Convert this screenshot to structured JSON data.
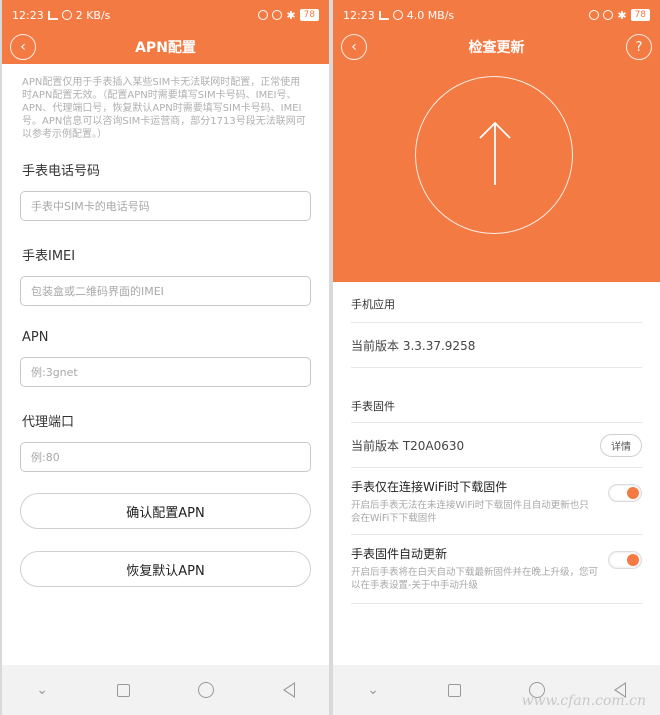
{
  "left": {
    "status": {
      "time": "12:23",
      "signal_text": "5G",
      "speed": "2 KB/s",
      "battery": "78"
    },
    "nav": {
      "title": "APN配置"
    },
    "description": "APN配置仅用于手表插入某些SIM卡无法联网时配置，正常使用时APN配置无效。（配置APN时需要填写SIM卡号码、IMEI号、APN、代理端口号，恢复默认APN时需要填写SIM卡号码、IMEI号。APN信息可以咨询SIM卡运营商，部分1713号段无法联网可以参考示例配置。）",
    "fields": [
      {
        "label": "手表电话号码",
        "placeholder": "手表中SIM卡的电话号码"
      },
      {
        "label": "手表IMEI",
        "placeholder": "包装盒或二维码界面的IMEI"
      },
      {
        "label": "APN",
        "placeholder": "例:3gnet"
      },
      {
        "label": "代理端口",
        "placeholder": "例:80"
      }
    ],
    "buttons": {
      "confirm": "确认配置APN",
      "restore": "恢复默认APN"
    }
  },
  "right": {
    "status": {
      "time": "12:23",
      "signal_text": "5G",
      "speed": "4.0 MB/s",
      "battery": "78"
    },
    "nav": {
      "title": "检查更新",
      "help": "?"
    },
    "app_section": {
      "title": "手机应用",
      "version": "当前版本 3.3.37.9258"
    },
    "firmware_section": {
      "title": "手表固件",
      "version": "当前版本 T20A0630",
      "detail": "详情"
    },
    "toggles": [
      {
        "title": "手表仅在连接WiFi时下载固件",
        "desc": "开启后手表无法在未连接WiFi时下载固件且自动更新也只会在WiFi下下载固件",
        "on": true
      },
      {
        "title": "手表固件自动更新",
        "desc": "开启后手表将在白天自动下载最新固件并在晚上升级，您可以在手表设置-关于中手动升级",
        "on": true
      }
    ]
  },
  "watermark": "www.cfan.com.cn",
  "colors": {
    "accent": "#f47a43"
  }
}
